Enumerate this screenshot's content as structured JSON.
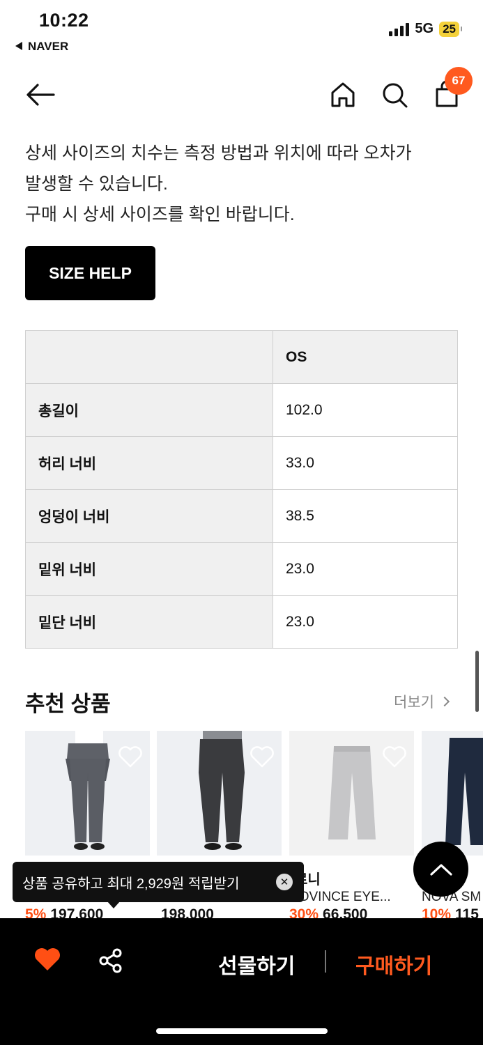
{
  "status_bar": {
    "time": "10:22",
    "back_app": "NAVER",
    "network": "5G",
    "battery": "25"
  },
  "header": {
    "cart_count": "67"
  },
  "notice": {
    "line1": "상세 사이즈의 치수는 측정 방법과 위치에 따라 오차가",
    "line2": "발생할 수 있습니다.",
    "line3": "구매 시 상세 사이즈를 확인 바랍니다."
  },
  "size_help_label": "SIZE HELP",
  "size_table": {
    "header": {
      "label": "",
      "value": "OS"
    },
    "rows": [
      {
        "label": "총길이",
        "value": "102.0"
      },
      {
        "label": "허리 너비",
        "value": "33.0"
      },
      {
        "label": "엉덩이 너비",
        "value": "38.5"
      },
      {
        "label": "밑위 너비",
        "value": "23.0"
      },
      {
        "label": "밑단 너비",
        "value": "23.0"
      }
    ]
  },
  "recommended": {
    "title": "추천 상품",
    "more_label": "더보기",
    "products": [
      {
        "brand": "",
        "name": "",
        "discount": "5%",
        "price": "197,600"
      },
      {
        "brand": "",
        "name": "",
        "discount": "",
        "price": "198,000"
      },
      {
        "brand": "로니",
        "name": "ROVINCE EYE...",
        "discount": "30%",
        "price": "66,500"
      },
      {
        "brand": "",
        "name": "NOVA SM",
        "discount": "10%",
        "price": "115"
      }
    ]
  },
  "toast": {
    "text": "상품 공유하고 최대 2,929원 적립받기",
    "close": "✕"
  },
  "bottom_bar": {
    "gift_label": "선물하기",
    "buy_label": "구매하기"
  },
  "colors": {
    "accent": "#ff5a1f",
    "black": "#000000",
    "table_header_bg": "#f0f0f0"
  }
}
